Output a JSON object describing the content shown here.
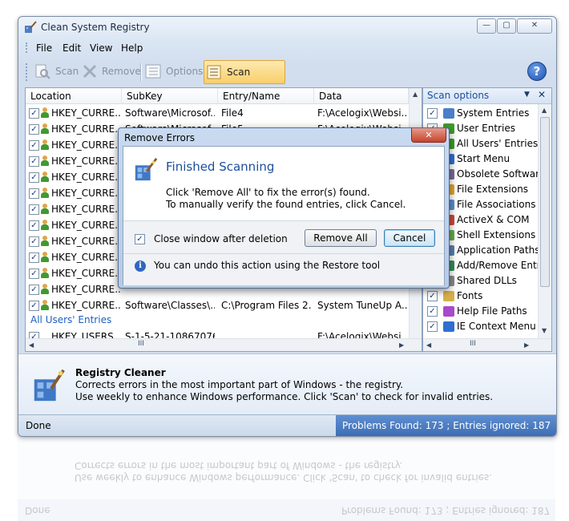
{
  "window": {
    "title": "Clean System Registry",
    "controls": {
      "minimize": "—",
      "maximize": "▢",
      "close": "✕"
    }
  },
  "menu": [
    "File",
    "Edit",
    "View",
    "Help"
  ],
  "toolbar": {
    "scan": "Scan",
    "remove": "Remove",
    "options": "Options",
    "scan_options": "Scan options",
    "help": "?"
  },
  "grid": {
    "columns": [
      "Location",
      "SubKey",
      "Entry/Name",
      "Data"
    ],
    "rows": [
      [
        "HKEY_CURRE...",
        "Software\\Microsof...",
        "File4",
        "F:\\Acelogix\\Websi..."
      ],
      [
        "HKEY_CURRE...",
        "Software\\Microsof...",
        "File5",
        "F:\\Acelogix\\Websi..."
      ],
      [
        "HKEY_CURRE...",
        "",
        "",
        ""
      ],
      [
        "HKEY_CURRE...",
        "",
        "",
        ""
      ],
      [
        "HKEY_CURRE...",
        "",
        "",
        ""
      ],
      [
        "HKEY_CURRE...",
        "",
        "",
        ""
      ],
      [
        "HKEY_CURRE...",
        "",
        "",
        ""
      ],
      [
        "HKEY_CURRE...",
        "",
        "",
        ""
      ],
      [
        "HKEY_CURRE...",
        "",
        "",
        ""
      ],
      [
        "HKEY_CURRE...",
        "",
        "",
        ""
      ],
      [
        "HKEY_CURRE...",
        "",
        "",
        ""
      ],
      [
        "HKEY_CURRE...",
        "",
        "",
        ""
      ],
      [
        "HKEY_CURRE...",
        "Software\\Classes\\...",
        "C:\\Program Files 2...",
        "System TuneUp A..."
      ]
    ],
    "group_label": "All Users' Entries",
    "partial_row": [
      "HKEY_USERS",
      "S-1-5-21-10867076...",
      "",
      "F:\\Acelogix\\Websi..."
    ],
    "hscroll_grip": "III"
  },
  "scan_panel": {
    "title": "Scan options",
    "items": [
      {
        "label": "System Entries",
        "color": "#4a7fc9"
      },
      {
        "label": "User Entries",
        "color": "#3f9b2d"
      },
      {
        "label": "All Users' Entries",
        "color": "#3f9b2d"
      },
      {
        "label": "Start Menu",
        "color": "#2f6fd0"
      },
      {
        "label": "Obsolete Software",
        "color": "#7a6a9c"
      },
      {
        "label": "File Extensions",
        "color": "#d9a43a"
      },
      {
        "label": "File Associations",
        "color": "#5a8ec9"
      },
      {
        "label": "ActiveX & COM",
        "color": "#c94a3a"
      },
      {
        "label": "Shell Extensions",
        "color": "#6aa84f"
      },
      {
        "label": "Application Paths",
        "color": "#5a7fb0"
      },
      {
        "label": "Add/Remove Entries",
        "color": "#3a8a5a"
      },
      {
        "label": "Shared DLLs",
        "color": "#8a8a8a"
      },
      {
        "label": "Fonts",
        "color": "#d8b04a"
      },
      {
        "label": "Help File Paths",
        "color": "#a84ac9"
      },
      {
        "label": "IE Context Menu",
        "color": "#2f6fd0"
      }
    ],
    "hscroll_grip": "III"
  },
  "info": {
    "title": "Registry Cleaner",
    "line1": "Corrects errors in the most important part of Windows - the registry.",
    "line2": "Use weekly to enhance Windows performance. Click 'Scan' to check for invalid entries."
  },
  "status": {
    "left": "Done",
    "right": "Problems Found: 173 ;  Entries ignored: 187"
  },
  "dialog": {
    "title": "Remove Errors",
    "heading": "Finished Scanning",
    "line1": "Click 'Remove All' to fix the error(s) found.",
    "line2": "To manually verify the found entries, click Cancel.",
    "checkbox_label": "Close window after deletion",
    "remove_all": "Remove All",
    "cancel": "Cancel",
    "info_text": "You can undo this action using the Restore tool",
    "close": "✕"
  }
}
